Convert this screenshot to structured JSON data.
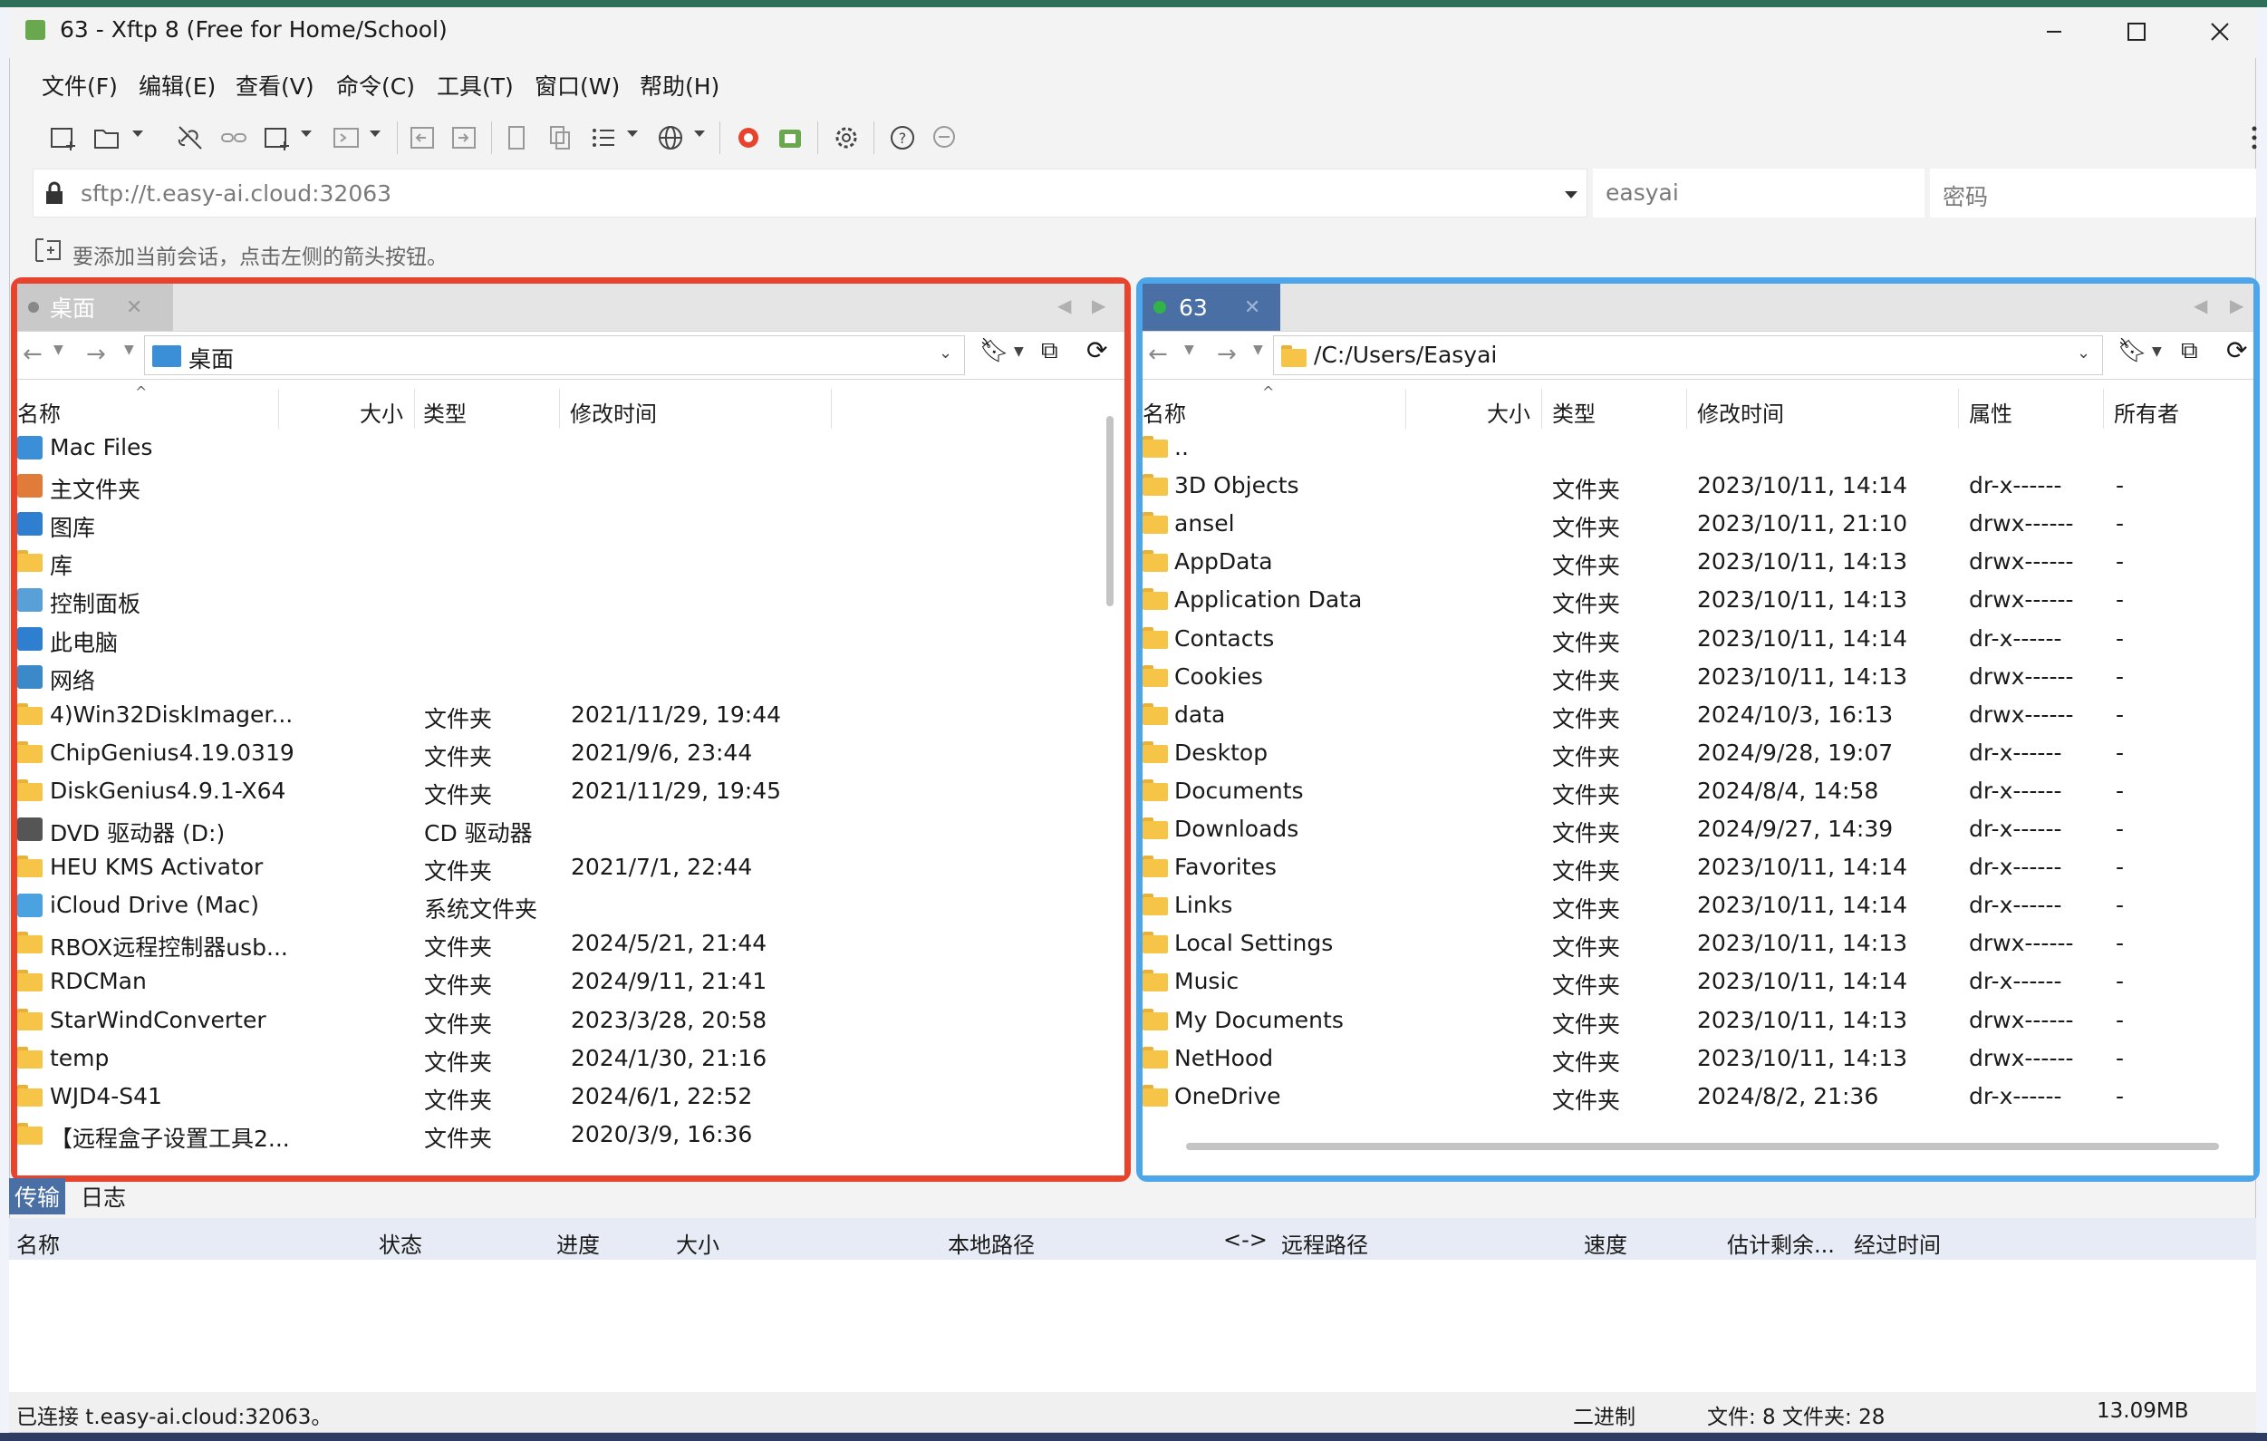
{
  "window": {
    "title": "63 - Xftp 8 (Free for Home/School)"
  },
  "menu": [
    "文件(F)",
    "编辑(E)",
    "查看(V)",
    "命令(C)",
    "工具(T)",
    "窗口(W)",
    "帮助(H)"
  ],
  "address": {
    "url": "sftp://t.easy-ai.cloud:32063",
    "username": "easyai",
    "password_placeholder": "密码"
  },
  "hint": "要添加当前会话，点击左侧的箭头按钮。",
  "local": {
    "tab_label": "桌面",
    "path": "桌面",
    "columns": [
      "名称",
      "大小",
      "类型",
      "修改时间"
    ],
    "rows": [
      {
        "name": "Mac Files",
        "type": "",
        "modified": "",
        "icon": "mac-files-icon"
      },
      {
        "name": "主文件夹",
        "type": "",
        "modified": "",
        "icon": "home-icon"
      },
      {
        "name": "图库",
        "type": "",
        "modified": "",
        "icon": "gallery-icon"
      },
      {
        "name": "库",
        "type": "",
        "modified": "",
        "icon": "folder-icon"
      },
      {
        "name": "控制面板",
        "type": "",
        "modified": "",
        "icon": "control-panel-icon"
      },
      {
        "name": "此电脑",
        "type": "",
        "modified": "",
        "icon": "computer-icon"
      },
      {
        "name": "网络",
        "type": "",
        "modified": "",
        "icon": "network-icon"
      },
      {
        "name": "4)Win32DiskImager...",
        "type": "文件夹",
        "modified": "2021/11/29, 19:44",
        "icon": "folder-icon"
      },
      {
        "name": "ChipGenius4.19.0319",
        "type": "文件夹",
        "modified": "2021/9/6, 23:44",
        "icon": "folder-icon"
      },
      {
        "name": "DiskGenius4.9.1-X64",
        "type": "文件夹",
        "modified": "2021/11/29, 19:45",
        "icon": "folder-icon"
      },
      {
        "name": "DVD 驱动器 (D:)",
        "type": "CD 驱动器",
        "modified": "",
        "icon": "dvd-drive-icon"
      },
      {
        "name": "HEU KMS Activator",
        "type": "文件夹",
        "modified": "2021/7/1, 22:44",
        "icon": "folder-icon"
      },
      {
        "name": "iCloud Drive (Mac)",
        "type": "系统文件夹",
        "modified": "",
        "icon": "icloud-icon"
      },
      {
        "name": "RBOX远程控制器usb...",
        "type": "文件夹",
        "modified": "2024/5/21, 21:44",
        "icon": "folder-icon"
      },
      {
        "name": "RDCMan",
        "type": "文件夹",
        "modified": "2024/9/11, 21:41",
        "icon": "folder-icon"
      },
      {
        "name": "StarWindConverter",
        "type": "文件夹",
        "modified": "2023/3/28, 20:58",
        "icon": "folder-icon"
      },
      {
        "name": "temp",
        "type": "文件夹",
        "modified": "2024/1/30, 21:16",
        "icon": "folder-icon"
      },
      {
        "name": "WJD4-S41",
        "type": "文件夹",
        "modified": "2024/6/1, 22:52",
        "icon": "folder-icon"
      },
      {
        "name": "【远程盒子设置工具2...",
        "type": "文件夹",
        "modified": "2020/3/9, 16:36",
        "icon": "folder-icon"
      }
    ]
  },
  "remote": {
    "tab_label": "63",
    "path": "/C:/Users/Easyai",
    "columns": [
      "名称",
      "大小",
      "类型",
      "修改时间",
      "属性",
      "所有者"
    ],
    "rows": [
      {
        "name": "..",
        "type": "",
        "modified": "",
        "attr": "",
        "owner": ""
      },
      {
        "name": "3D Objects",
        "type": "文件夹",
        "modified": "2023/10/11, 14:14",
        "attr": "dr-x------",
        "owner": "-"
      },
      {
        "name": "ansel",
        "type": "文件夹",
        "modified": "2023/10/11, 21:10",
        "attr": "drwx------",
        "owner": "-"
      },
      {
        "name": "AppData",
        "type": "文件夹",
        "modified": "2023/10/11, 14:13",
        "attr": "drwx------",
        "owner": "-"
      },
      {
        "name": "Application Data",
        "type": "文件夹",
        "modified": "2023/10/11, 14:13",
        "attr": "drwx------",
        "owner": "-"
      },
      {
        "name": "Contacts",
        "type": "文件夹",
        "modified": "2023/10/11, 14:14",
        "attr": "dr-x------",
        "owner": "-"
      },
      {
        "name": "Cookies",
        "type": "文件夹",
        "modified": "2023/10/11, 14:13",
        "attr": "drwx------",
        "owner": "-"
      },
      {
        "name": "data",
        "type": "文件夹",
        "modified": "2024/10/3, 16:13",
        "attr": "drwx------",
        "owner": "-"
      },
      {
        "name": "Desktop",
        "type": "文件夹",
        "modified": "2024/9/28, 19:07",
        "attr": "dr-x------",
        "owner": "-"
      },
      {
        "name": "Documents",
        "type": "文件夹",
        "modified": "2024/8/4, 14:58",
        "attr": "dr-x------",
        "owner": "-"
      },
      {
        "name": "Downloads",
        "type": "文件夹",
        "modified": "2024/9/27, 14:39",
        "attr": "dr-x------",
        "owner": "-"
      },
      {
        "name": "Favorites",
        "type": "文件夹",
        "modified": "2023/10/11, 14:14",
        "attr": "dr-x------",
        "owner": "-"
      },
      {
        "name": "Links",
        "type": "文件夹",
        "modified": "2023/10/11, 14:14",
        "attr": "dr-x------",
        "owner": "-"
      },
      {
        "name": "Local Settings",
        "type": "文件夹",
        "modified": "2023/10/11, 14:13",
        "attr": "drwx------",
        "owner": "-"
      },
      {
        "name": "Music",
        "type": "文件夹",
        "modified": "2023/10/11, 14:14",
        "attr": "dr-x------",
        "owner": "-"
      },
      {
        "name": "My Documents",
        "type": "文件夹",
        "modified": "2023/10/11, 14:13",
        "attr": "drwx------",
        "owner": "-"
      },
      {
        "name": "NetHood",
        "type": "文件夹",
        "modified": "2023/10/11, 14:13",
        "attr": "drwx------",
        "owner": "-"
      },
      {
        "name": "OneDrive",
        "type": "文件夹",
        "modified": "2024/8/2, 21:36",
        "attr": "dr-x------",
        "owner": "-"
      }
    ]
  },
  "transfer": {
    "tabs": [
      "传输",
      "日志"
    ],
    "columns": [
      "名称",
      "状态",
      "进度",
      "大小",
      "本地路径",
      "<->",
      "远程路径",
      "速度",
      "估计剩余...",
      "经过时间"
    ]
  },
  "status": {
    "connection": "已连接 t.easy-ai.cloud:32063。",
    "mode": "二进制",
    "counts": "文件: 8  文件夹: 28",
    "size": "13.09MB"
  },
  "colors": {
    "local_frame": "#e8432d",
    "remote_frame": "#4ea6ea",
    "folder": "#f6c447",
    "remote_dot": "#33b24a",
    "active_tab": "#4a6fa5"
  }
}
